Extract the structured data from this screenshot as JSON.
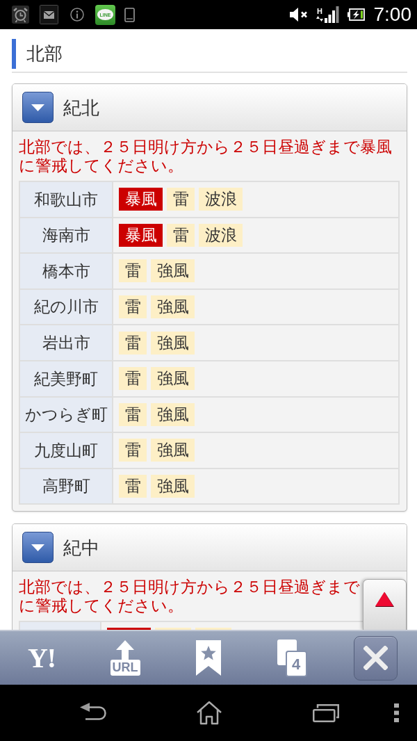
{
  "status_bar": {
    "app_icon_label": "LINE",
    "network_type": "H",
    "time": "7:00"
  },
  "section": {
    "title": "北部"
  },
  "cards": [
    {
      "title": "紀北",
      "warning": [
        "北部では、２５日明け方から２５日昼過ぎまで暴風",
        "に警戒してください。"
      ],
      "rows": [
        {
          "area": "和歌山市",
          "tags": [
            {
              "label": "暴風",
              "kind": "warning"
            },
            {
              "label": "雷",
              "kind": "advisory"
            },
            {
              "label": "波浪",
              "kind": "advisory"
            }
          ]
        },
        {
          "area": "海南市",
          "tags": [
            {
              "label": "暴風",
              "kind": "warning"
            },
            {
              "label": "雷",
              "kind": "advisory"
            },
            {
              "label": "波浪",
              "kind": "advisory"
            }
          ]
        },
        {
          "area": "橋本市",
          "tags": [
            {
              "label": "雷",
              "kind": "advisory"
            },
            {
              "label": "強風",
              "kind": "advisory"
            }
          ]
        },
        {
          "area": "紀の川市",
          "tags": [
            {
              "label": "雷",
              "kind": "advisory"
            },
            {
              "label": "強風",
              "kind": "advisory"
            }
          ]
        },
        {
          "area": "岩出市",
          "tags": [
            {
              "label": "雷",
              "kind": "advisory"
            },
            {
              "label": "強風",
              "kind": "advisory"
            }
          ]
        },
        {
          "area": "紀美野町",
          "tags": [
            {
              "label": "雷",
              "kind": "advisory"
            },
            {
              "label": "強風",
              "kind": "advisory"
            }
          ]
        },
        {
          "area": "かつらぎ町",
          "tags": [
            {
              "label": "雷",
              "kind": "advisory"
            },
            {
              "label": "強風",
              "kind": "advisory"
            }
          ]
        },
        {
          "area": "九度山町",
          "tags": [
            {
              "label": "雷",
              "kind": "advisory"
            },
            {
              "label": "強風",
              "kind": "advisory"
            }
          ]
        },
        {
          "area": "高野町",
          "tags": [
            {
              "label": "雷",
              "kind": "advisory"
            },
            {
              "label": "強風",
              "kind": "advisory"
            }
          ]
        }
      ]
    },
    {
      "title": "紀中",
      "warning": [
        "北部では、２５日明け方から２５日昼過ぎまで",
        "に警戒してください。"
      ],
      "rows": [
        {
          "tags": [
            {
              "kind": "warning"
            },
            {
              "kind": "advisory"
            },
            {
              "kind": "advisory"
            }
          ]
        }
      ]
    }
  ],
  "toolbar": {
    "logo": "Y!",
    "url_label": "URL",
    "tab_count": "4"
  }
}
